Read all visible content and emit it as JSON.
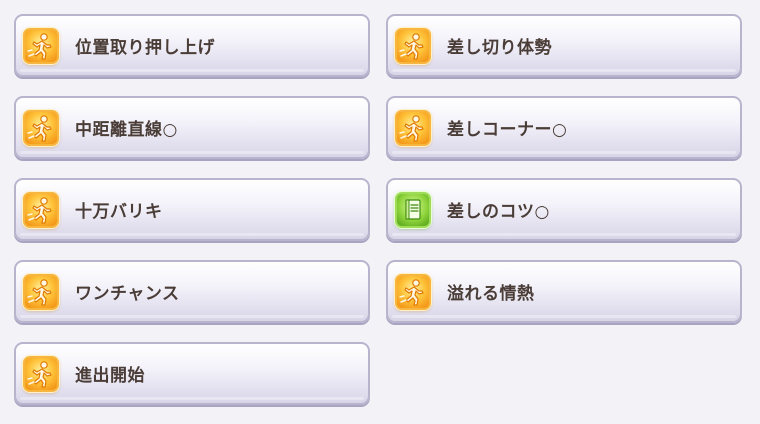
{
  "skills": [
    {
      "label": "位置取り押し上げ",
      "icon": "runner-icon",
      "color": "gold"
    },
    {
      "label": "差し切り体勢",
      "icon": "runner-icon",
      "color": "gold"
    },
    {
      "label": "中距離直線○",
      "icon": "runner-icon",
      "color": "gold"
    },
    {
      "label": "差しコーナー○",
      "icon": "runner-icon",
      "color": "gold"
    },
    {
      "label": "十万バリキ",
      "icon": "runner-icon",
      "color": "gold"
    },
    {
      "label": "差しのコツ○",
      "icon": "book-icon",
      "color": "green"
    },
    {
      "label": "ワンチャンス",
      "icon": "runner-icon",
      "color": "gold"
    },
    {
      "label": "溢れる情熱",
      "icon": "runner-icon",
      "color": "gold"
    },
    {
      "label": "進出開始",
      "icon": "runner-icon",
      "color": "gold"
    }
  ],
  "colors": {
    "gold_icon": "#ffc43b",
    "green_icon": "#8fd43c",
    "label_text": "#4a3c36",
    "button_border": "#b9b4cd"
  }
}
